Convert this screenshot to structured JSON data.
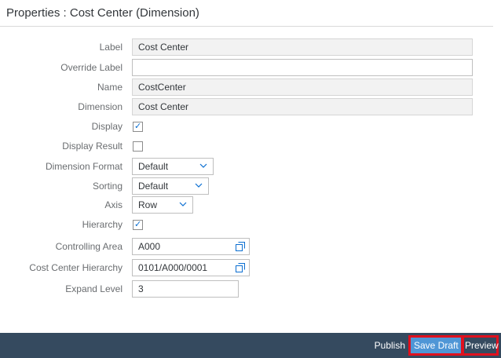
{
  "header": {
    "title": "Properties : Cost Center (Dimension)"
  },
  "form": {
    "label": {
      "label": "Label",
      "value": "Cost Center"
    },
    "override_label": {
      "label": "Override Label",
      "value": ""
    },
    "name": {
      "label": "Name",
      "value": "CostCenter"
    },
    "dimension": {
      "label": "Dimension",
      "value": "Cost Center"
    },
    "display": {
      "label": "Display",
      "checked": true
    },
    "display_result": {
      "label": "Display Result",
      "checked": false
    },
    "dimension_format": {
      "label": "Dimension Format",
      "value": "Default"
    },
    "sorting": {
      "label": "Sorting",
      "value": "Default"
    },
    "axis": {
      "label": "Axis",
      "value": "Row"
    },
    "hierarchy": {
      "label": "Hierarchy",
      "checked": true
    },
    "controlling_area": {
      "label": "Controlling Area",
      "value": "A000"
    },
    "cost_center_hierarchy": {
      "label": "Cost Center Hierarchy",
      "value": "0101/A000/0001"
    },
    "expand_level": {
      "label": "Expand Level",
      "value": "3"
    }
  },
  "footer": {
    "publish_label": "Publish",
    "save_draft_label": "Save Draft",
    "preview_label": "Preview"
  },
  "colors": {
    "footer_bg": "#354a5f",
    "accent": "#0a6ed1",
    "save_button": "#4f96d6",
    "highlight": "#e0111e"
  }
}
